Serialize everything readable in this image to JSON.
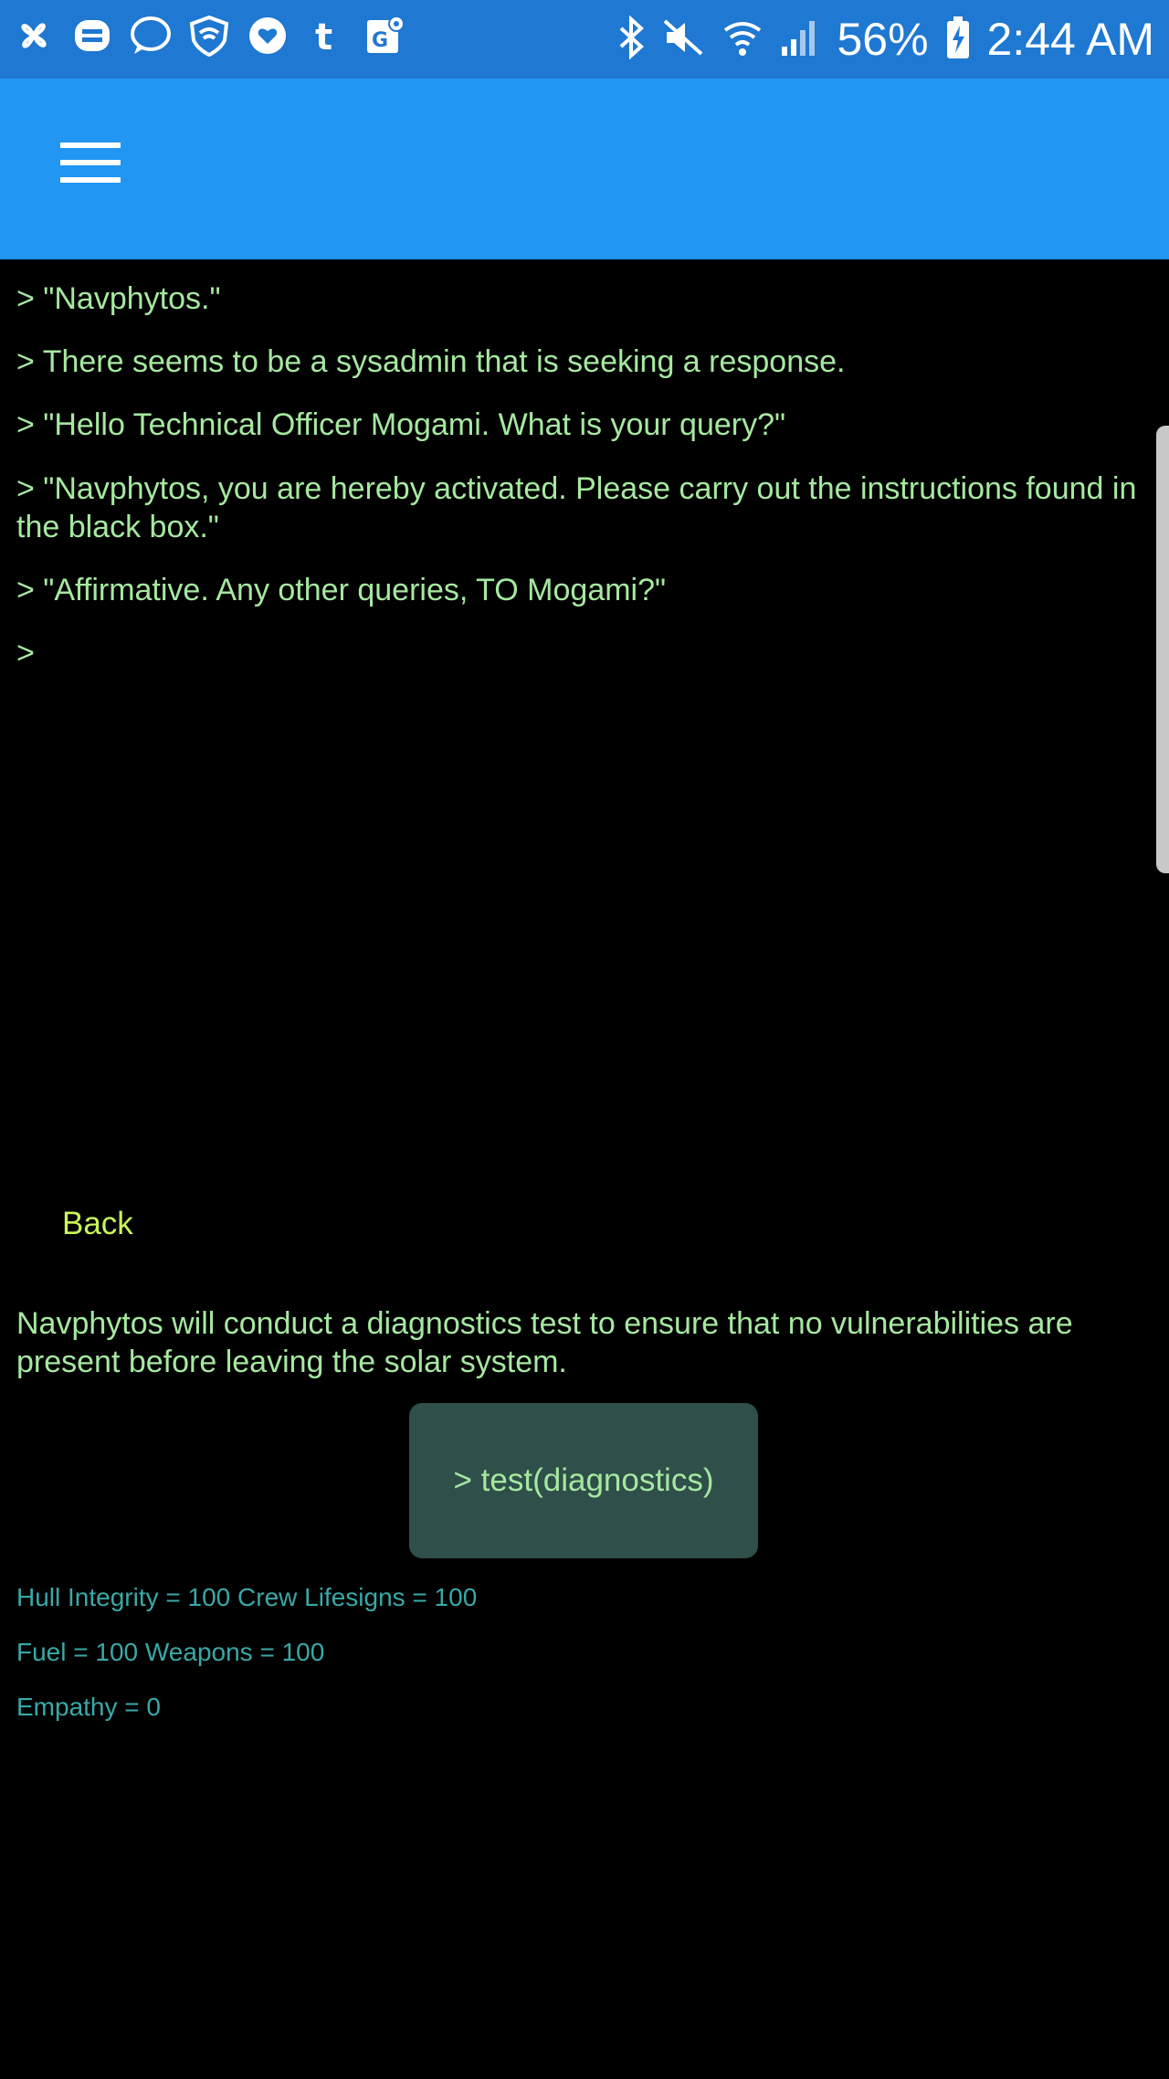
{
  "status_bar": {
    "battery": "56%",
    "time": "2:44 AM",
    "icons": [
      "pinwheel-icon",
      "bridgefy-icon",
      "messenger-icon",
      "shield-wifi-icon",
      "heart-icon",
      "tumblr-icon",
      "maps-icon"
    ],
    "right_icons": [
      "bluetooth-icon",
      "mute-icon",
      "wifi-icon",
      "signal-icon",
      "battery-charging-icon"
    ]
  },
  "appbar": {
    "menu_icon": "hamburger-menu-icon",
    "color": "#2196f3"
  },
  "log": {
    "lines": [
      "> \"Navphytos.\"",
      "> There seems to be a sysadmin that is seeking a response.",
      "> \"Hello Technical Officer Mogami. What is your query?\"",
      "> \"Navphytos, you are hereby activated. Please carry out the instructions found in the black box.\"",
      "> \"Affirmative. Any other queries, TO Mogami?\"",
      ">"
    ]
  },
  "back_label": "Back",
  "description": "Navphytos will conduct a diagnostics test to ensure that no vulnerabilities are present before leaving the solar system.",
  "action_button": "> test(diagnostics)",
  "stats": {
    "line1": "Hull Integrity = 100  Crew Lifesigns = 100",
    "line2": "Fuel = 100  Weapons = 100",
    "line3": "Empathy = 0"
  },
  "colors": {
    "text_green": "#a6e8a0",
    "back_yellow": "#c8f55a",
    "stat_teal": "#3aa8a8",
    "button_bg": "#2f4f4a"
  }
}
